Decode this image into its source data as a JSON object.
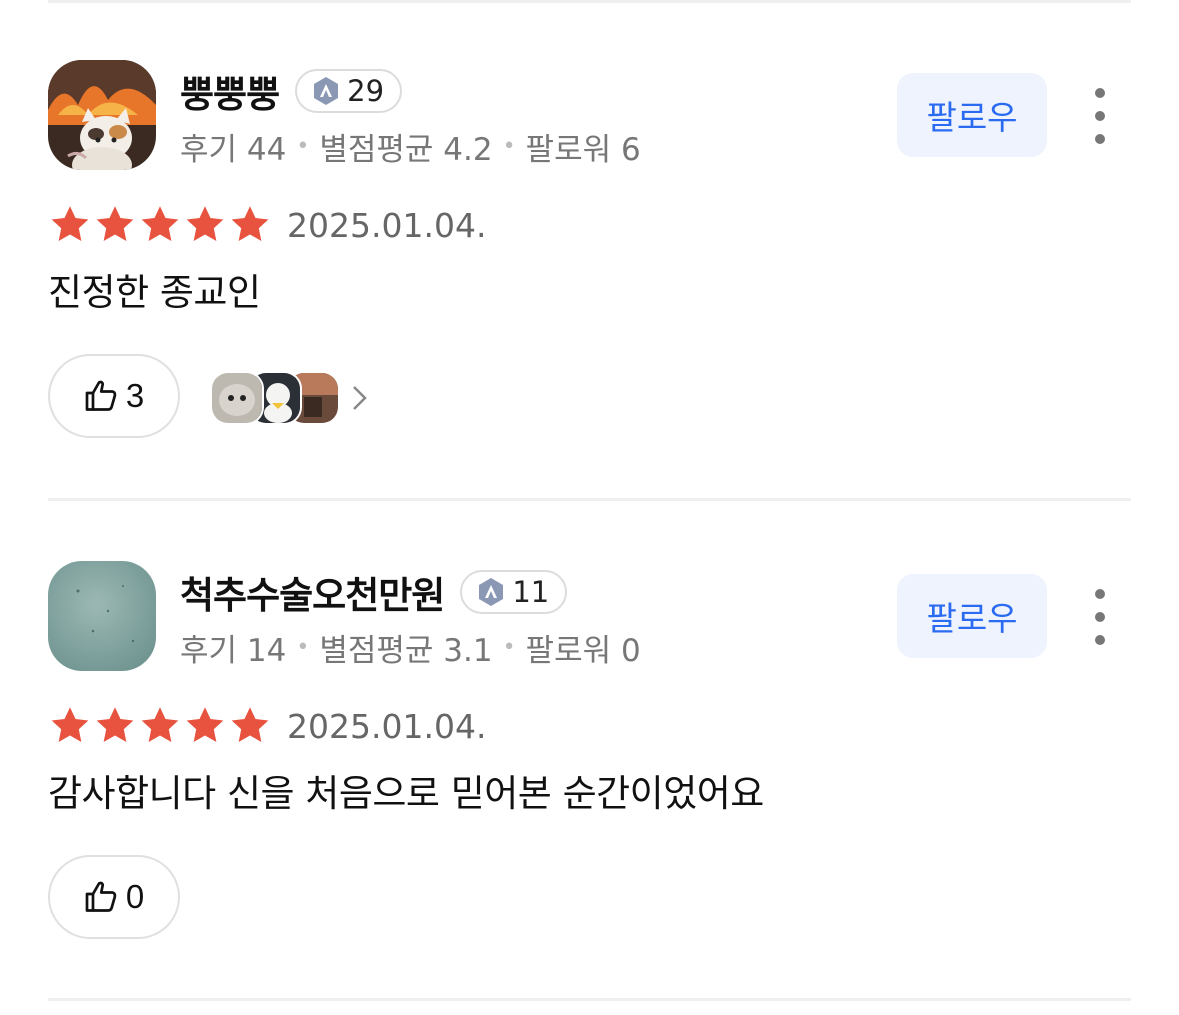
{
  "reviews": [
    {
      "username": "뿡뿡뿡",
      "level": "29",
      "stats": {
        "reviews_label": "후기 44",
        "avg_label": "별점평균 4.2",
        "followers_label": "팔로워 6"
      },
      "follow_label": "팔로우",
      "rating": 5,
      "date": "2025.01.04.",
      "text": "진정한 종교인",
      "likes": "3"
    },
    {
      "username": "척추수술오천만원",
      "level": "11",
      "stats": {
        "reviews_label": "후기 14",
        "avg_label": "별점평균 3.1",
        "followers_label": "팔로워 0"
      },
      "follow_label": "팔로우",
      "rating": 5,
      "date": "2025.01.04.",
      "text": "감사합니다 신을 처음으로 믿어본 순간이었어요",
      "likes": "0"
    }
  ],
  "colors": {
    "star": "#e8533f",
    "accent": "#2a6bf2",
    "follow_bg": "#eef3fd"
  }
}
